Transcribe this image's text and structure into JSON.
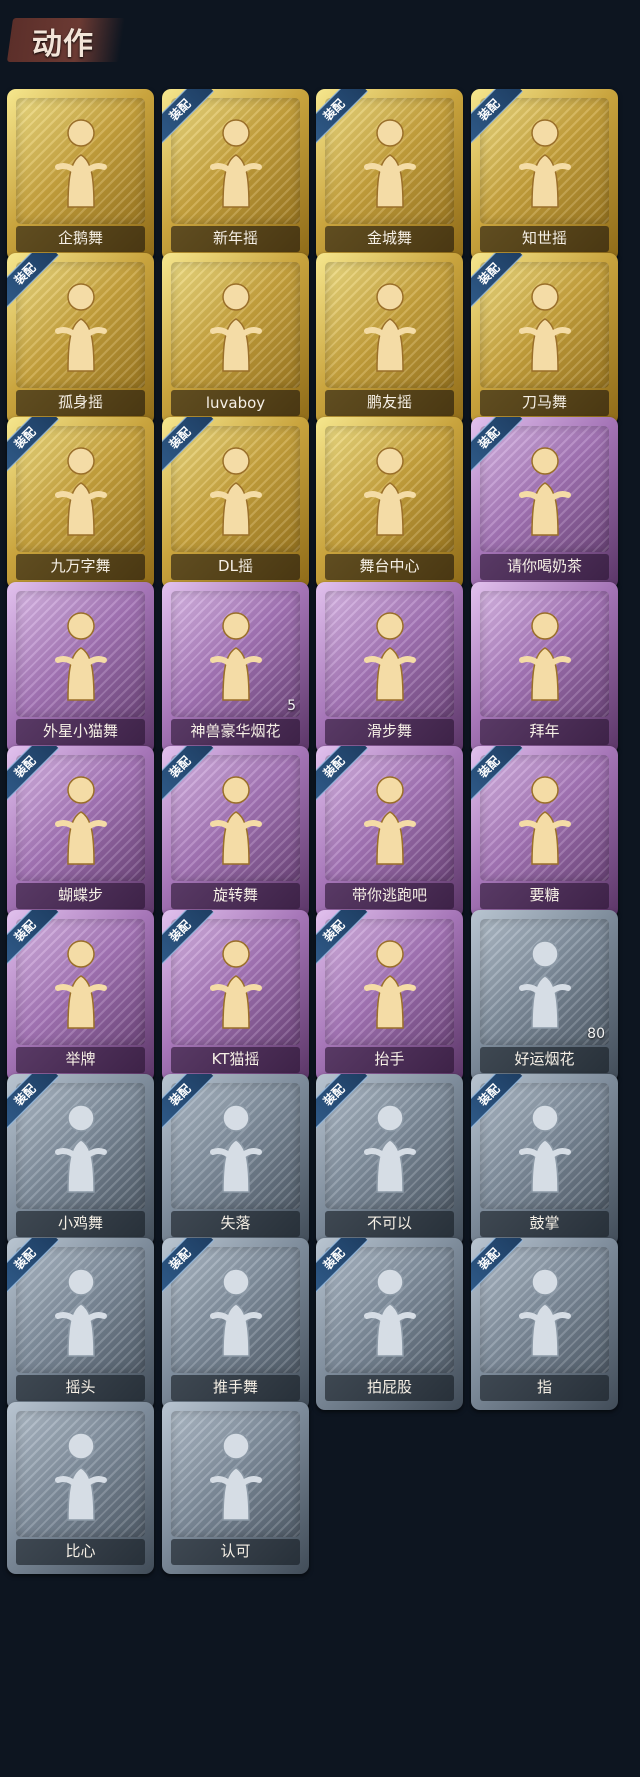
{
  "header": {
    "title": "动作"
  },
  "badges": {
    "equipped": "装配"
  },
  "tiers": {
    "gold": "#c9a43e",
    "purple": "#a676b8",
    "silver": "#7f8d9c"
  },
  "actions": [
    {
      "name": "企鹅舞",
      "tier": "gold",
      "equipped": false,
      "icon": "penguin-dance-icon"
    },
    {
      "name": "新年摇",
      "tier": "gold",
      "equipped": true,
      "icon": "new-year-shake-icon"
    },
    {
      "name": "金城舞",
      "tier": "gold",
      "equipped": true,
      "icon": "jincheng-dance-icon"
    },
    {
      "name": "知世摇",
      "tier": "gold",
      "equipped": true,
      "icon": "zhishi-shake-icon"
    },
    {
      "name": "孤身摇",
      "tier": "gold",
      "equipped": true,
      "icon": "solo-shake-icon"
    },
    {
      "name": "luvaboy",
      "tier": "gold",
      "equipped": false,
      "icon": "luvaboy-icon"
    },
    {
      "name": "鹏友摇",
      "tier": "gold",
      "equipped": false,
      "icon": "friend-shake-icon"
    },
    {
      "name": "刀马舞",
      "tier": "gold",
      "equipped": true,
      "icon": "sword-horse-dance-icon"
    },
    {
      "name": "九万字舞",
      "tier": "gold",
      "equipped": true,
      "icon": "ninety-thousand-dance-icon"
    },
    {
      "name": "DL摇",
      "tier": "gold",
      "equipped": true,
      "icon": "dl-shake-icon"
    },
    {
      "name": "舞台中心",
      "tier": "gold",
      "equipped": false,
      "icon": "center-stage-icon"
    },
    {
      "name": "请你喝奶茶",
      "tier": "purple",
      "equipped": true,
      "icon": "milk-tea-icon"
    },
    {
      "name": "外星小猫舞",
      "tier": "purple",
      "equipped": false,
      "icon": "alien-cat-dance-icon"
    },
    {
      "name": "神兽豪华烟花",
      "tier": "purple",
      "equipped": false,
      "icon": "fireworks-icon",
      "count": "5"
    },
    {
      "name": "滑步舞",
      "tier": "purple",
      "equipped": false,
      "icon": "slide-step-icon"
    },
    {
      "name": "拜年",
      "tier": "purple",
      "equipped": false,
      "icon": "new-year-greeting-icon"
    },
    {
      "name": "蝴蝶步",
      "tier": "purple",
      "equipped": true,
      "icon": "butterfly-step-icon"
    },
    {
      "name": "旋转舞",
      "tier": "purple",
      "equipped": true,
      "icon": "spin-dance-icon"
    },
    {
      "name": "带你逃跑吧",
      "tier": "purple",
      "equipped": true,
      "icon": "run-away-icon"
    },
    {
      "name": "要糖",
      "tier": "purple",
      "equipped": true,
      "icon": "ask-candy-icon"
    },
    {
      "name": "举牌",
      "tier": "purple",
      "equipped": true,
      "icon": "hold-sign-icon"
    },
    {
      "name": "KT猫摇",
      "tier": "purple",
      "equipped": true,
      "icon": "kt-cat-shake-icon"
    },
    {
      "name": "抬手",
      "tier": "purple",
      "equipped": true,
      "icon": "raise-hand-icon"
    },
    {
      "name": "好运烟花",
      "tier": "silver",
      "equipped": false,
      "icon": "lucky-firework-icon",
      "count": "80"
    },
    {
      "name": "小鸡舞",
      "tier": "silver",
      "equipped": true,
      "icon": "chicken-dance-icon"
    },
    {
      "name": "失落",
      "tier": "silver",
      "equipped": true,
      "icon": "dejected-icon"
    },
    {
      "name": "不可以",
      "tier": "silver",
      "equipped": true,
      "icon": "no-finger-icon"
    },
    {
      "name": "鼓掌",
      "tier": "silver",
      "equipped": true,
      "icon": "clap-icon"
    },
    {
      "name": "摇头",
      "tier": "silver",
      "equipped": true,
      "icon": "shake-head-icon"
    },
    {
      "name": "推手舞",
      "tier": "silver",
      "equipped": true,
      "icon": "push-hands-icon"
    },
    {
      "name": "拍屁股",
      "tier": "silver",
      "equipped": true,
      "icon": "pat-butt-icon"
    },
    {
      "name": "指",
      "tier": "silver",
      "equipped": true,
      "icon": "point-icon"
    },
    {
      "name": "比心",
      "tier": "silver",
      "equipped": false,
      "icon": "finger-heart-icon"
    },
    {
      "name": "认可",
      "tier": "silver",
      "equipped": false,
      "icon": "thumbs-up-icon"
    }
  ]
}
